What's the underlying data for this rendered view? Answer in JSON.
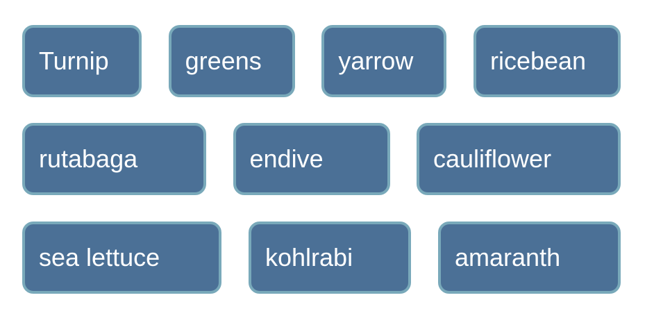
{
  "tiles": {
    "row1": [
      "Turnip",
      "greens",
      "yarrow",
      "ricebean"
    ],
    "row2": [
      "rutabaga",
      "endive",
      "cauliflower"
    ],
    "row3": [
      "sea lettuce",
      "kohlrabi",
      "amaranth"
    ]
  },
  "colors": {
    "tile_fill": "#4b7096",
    "tile_border": "#79a9ba",
    "tile_text": "#ffffff",
    "background": "#ffffff"
  }
}
